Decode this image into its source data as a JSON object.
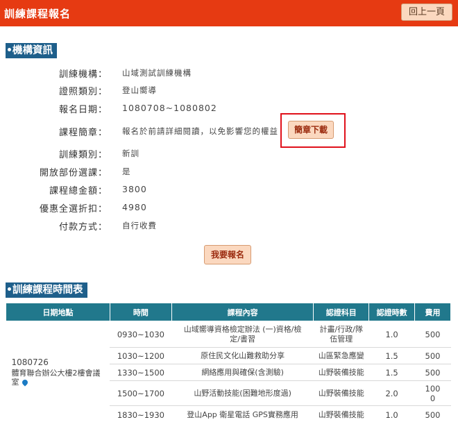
{
  "header": {
    "title": "訓練課程報名",
    "back_label": "回上一頁"
  },
  "org_section": {
    "heading": "機構資訊",
    "rows": [
      {
        "label": "訓練機構：",
        "value": "山域測試訓練機構"
      },
      {
        "label": "證照類別：",
        "value": "登山嚮導"
      },
      {
        "label": "報名日期：",
        "value": "1080708~1080802"
      },
      {
        "label": "課程簡章：",
        "value": "報名於前請詳細閱讀，以免影響您的權益"
      },
      {
        "label": "訓練類別：",
        "value": "新訓"
      },
      {
        "label": "開放部份選課：",
        "value": "是"
      },
      {
        "label": "課程總金額：",
        "value": "3800"
      },
      {
        "label": "優惠全選折扣：",
        "value": "4980"
      },
      {
        "label": "付款方式：",
        "value": "自行收費"
      }
    ],
    "download_label": "簡章下載",
    "signup_label": "我要報名"
  },
  "schedule_section": {
    "heading": "訓練課程時間表",
    "columns": [
      "日期地點",
      "時間",
      "課程內容",
      "認證科目",
      "認證時數",
      "費用"
    ],
    "date_location": {
      "date": "1080726",
      "place": "體育聯合辦公大樓2樓會議室"
    },
    "rows": [
      {
        "time": "0930~1030",
        "content": "山域嚮導資格檢定辦法 (一)資格/檢定/書習",
        "subject": "計畫/行政/隊伍管理",
        "hours": "1.0",
        "fee": "500"
      },
      {
        "time": "1030~1200",
        "content": "原住民文化山難救助分享",
        "subject": "山區緊急應變",
        "hours": "1.5",
        "fee": "500"
      },
      {
        "time": "1330~1500",
        "content": "網絡應用與確保(含測驗)",
        "subject": "山野裝備技能",
        "hours": "1.5",
        "fee": "500"
      },
      {
        "time": "1500~1700",
        "content": "山野活動技能(困難地形度過)",
        "subject": "山野裝備技能",
        "hours": "2.0",
        "fee": "1000"
      },
      {
        "time": "1830~1930",
        "content": "登山App 衛星電話 GPS實務應用",
        "subject": "山野裝備技能",
        "hours": "1.0",
        "fee": "500"
      }
    ]
  }
}
